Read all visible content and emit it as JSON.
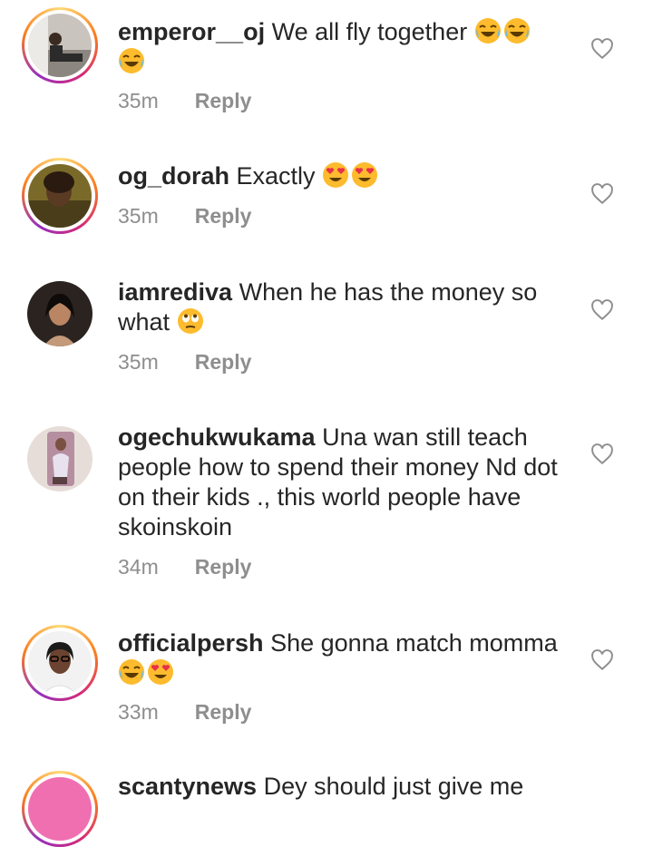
{
  "comments": [
    {
      "username": "emperor__oj",
      "text": "We all fly together",
      "emojis": [
        "joy-emoji",
        "joy-emoji",
        "joy-emoji"
      ],
      "time": "35m",
      "reply": "Reply"
    },
    {
      "username": "og_dorah",
      "text": "Exactly",
      "emojis": [
        "heart-eyes-emoji",
        "heart-eyes-emoji"
      ],
      "time": "35m",
      "reply": "Reply"
    },
    {
      "username": "iamrediva",
      "text": "When he has the money so what",
      "emojis": [
        "eye-roll-emoji"
      ],
      "time": "35m",
      "reply": "Reply"
    },
    {
      "username": "ogechukwukama",
      "text": "Una wan still teach people how to spend their money Nd dot on their kids ., this world people have skoinskoin",
      "emojis": [],
      "time": "34m",
      "reply": "Reply"
    },
    {
      "username": "officialpersh",
      "text": "She gonna match momma",
      "emojis": [
        "joy-emoji",
        "heart-eyes-emoji"
      ],
      "time": "33m",
      "reply": "Reply"
    },
    {
      "username": "scantynews",
      "text": "Dey should just give me",
      "emojis": [],
      "time": "",
      "reply": ""
    }
  ],
  "colors": {
    "text": "#262626",
    "meta": "#8e8e8e",
    "emoji": "#fdbb2d",
    "heart_eyes": "#e8304a"
  }
}
